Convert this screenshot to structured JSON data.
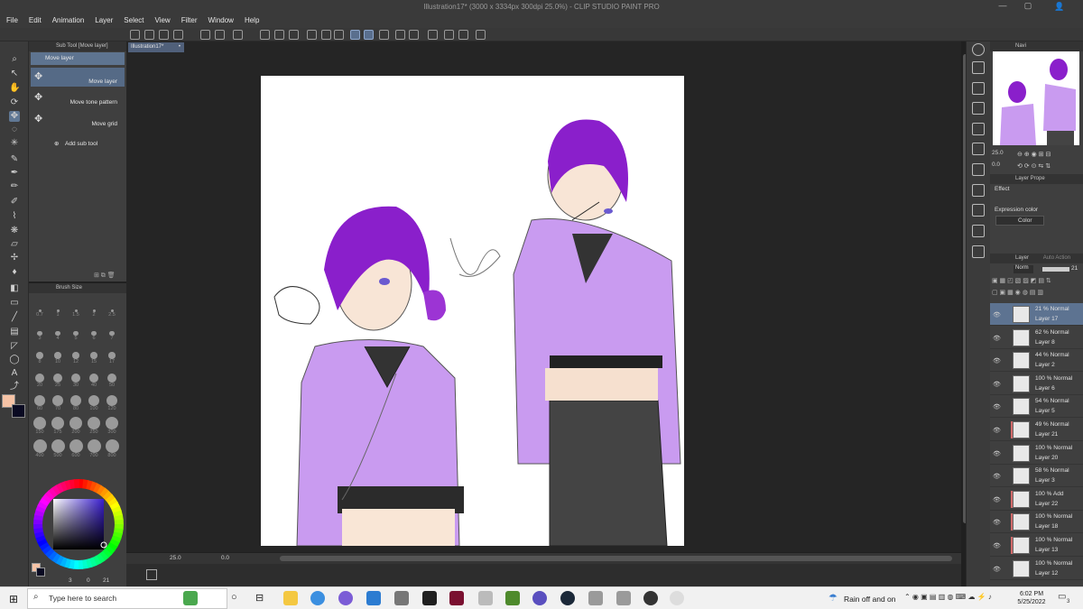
{
  "window": {
    "title": "Illustration17* (3000 x 3334px 300dpi 25.0%)  -  CLIP STUDIO PAINT PRO"
  },
  "menu": [
    "File",
    "Edit",
    "Animation",
    "Layer",
    "Select",
    "View",
    "Filter",
    "Window",
    "Help"
  ],
  "document_tab": {
    "label": "Illustration17*"
  },
  "subtool": {
    "header": "Sub Tool [Move layer]",
    "group_label": "Move layer",
    "items": [
      {
        "label": "Move layer",
        "icon": "move-arrows-icon",
        "selected": true
      },
      {
        "label": "Move tone pattern",
        "icon": "move-arrows-icon"
      },
      {
        "label": "Move grid",
        "icon": "move-arrows-icon"
      }
    ],
    "add_label": "Add sub tool"
  },
  "brush_size": {
    "header": "Brush Size",
    "sizes": [
      "0.7",
      "1",
      "1.5",
      "2",
      "2.5",
      "3",
      "4",
      "5",
      "6",
      "7",
      "8",
      "10",
      "12",
      "15",
      "17",
      "20",
      "25",
      "30",
      "40",
      "50",
      "60",
      "70",
      "80",
      "100",
      "120",
      "150",
      "175",
      "200",
      "250",
      "300",
      "400",
      "500",
      "600",
      "700",
      "800"
    ]
  },
  "color": {
    "main": "#f6c3a6",
    "sub": "#0a0a22",
    "wheel_selected": "#4b3a9a",
    "bottom_values": [
      "3",
      "0",
      "21"
    ]
  },
  "canvas": {
    "zoom": "25.0",
    "rotation": "0.0"
  },
  "navigator": {
    "header": "Navi",
    "zoom": "25.0",
    "rotation": "0.0"
  },
  "layer_property": {
    "header": "Layer Prope",
    "effect_label": "Effect",
    "expression_label": "Expression color",
    "expression_value": "Color"
  },
  "layer_panel": {
    "header": "Layer",
    "tab2": "Auto Action",
    "blend": "Norm",
    "opacity": "21",
    "layers": [
      {
        "mode": "21 % Normal",
        "name": "Layer 17",
        "selected": true
      },
      {
        "mode": "62 % Normal",
        "name": "Layer 8"
      },
      {
        "mode": "44 % Normal",
        "name": "Layer 2"
      },
      {
        "mode": "100 % Normal",
        "name": "Layer 6"
      },
      {
        "mode": "54 % Normal",
        "name": "Layer 5"
      },
      {
        "mode": "49 % Normal",
        "name": "Layer 21",
        "marked": true
      },
      {
        "mode": "100 % Normal",
        "name": "Layer 20"
      },
      {
        "mode": "58 % Normal",
        "name": "Layer 3"
      },
      {
        "mode": "100 % Add",
        "name": "Layer 22",
        "marked": true
      },
      {
        "mode": "100 % Normal",
        "name": "Layer 18",
        "marked": true
      },
      {
        "mode": "100 % Normal",
        "name": "Layer 13",
        "marked": true
      },
      {
        "mode": "100 % Normal",
        "name": "Layer 12"
      }
    ]
  },
  "taskbar": {
    "search_placeholder": "Type here to search",
    "weather": "Rain off and on",
    "time": "6:02 PM",
    "date": "5/25/2022",
    "notifications": "3"
  }
}
